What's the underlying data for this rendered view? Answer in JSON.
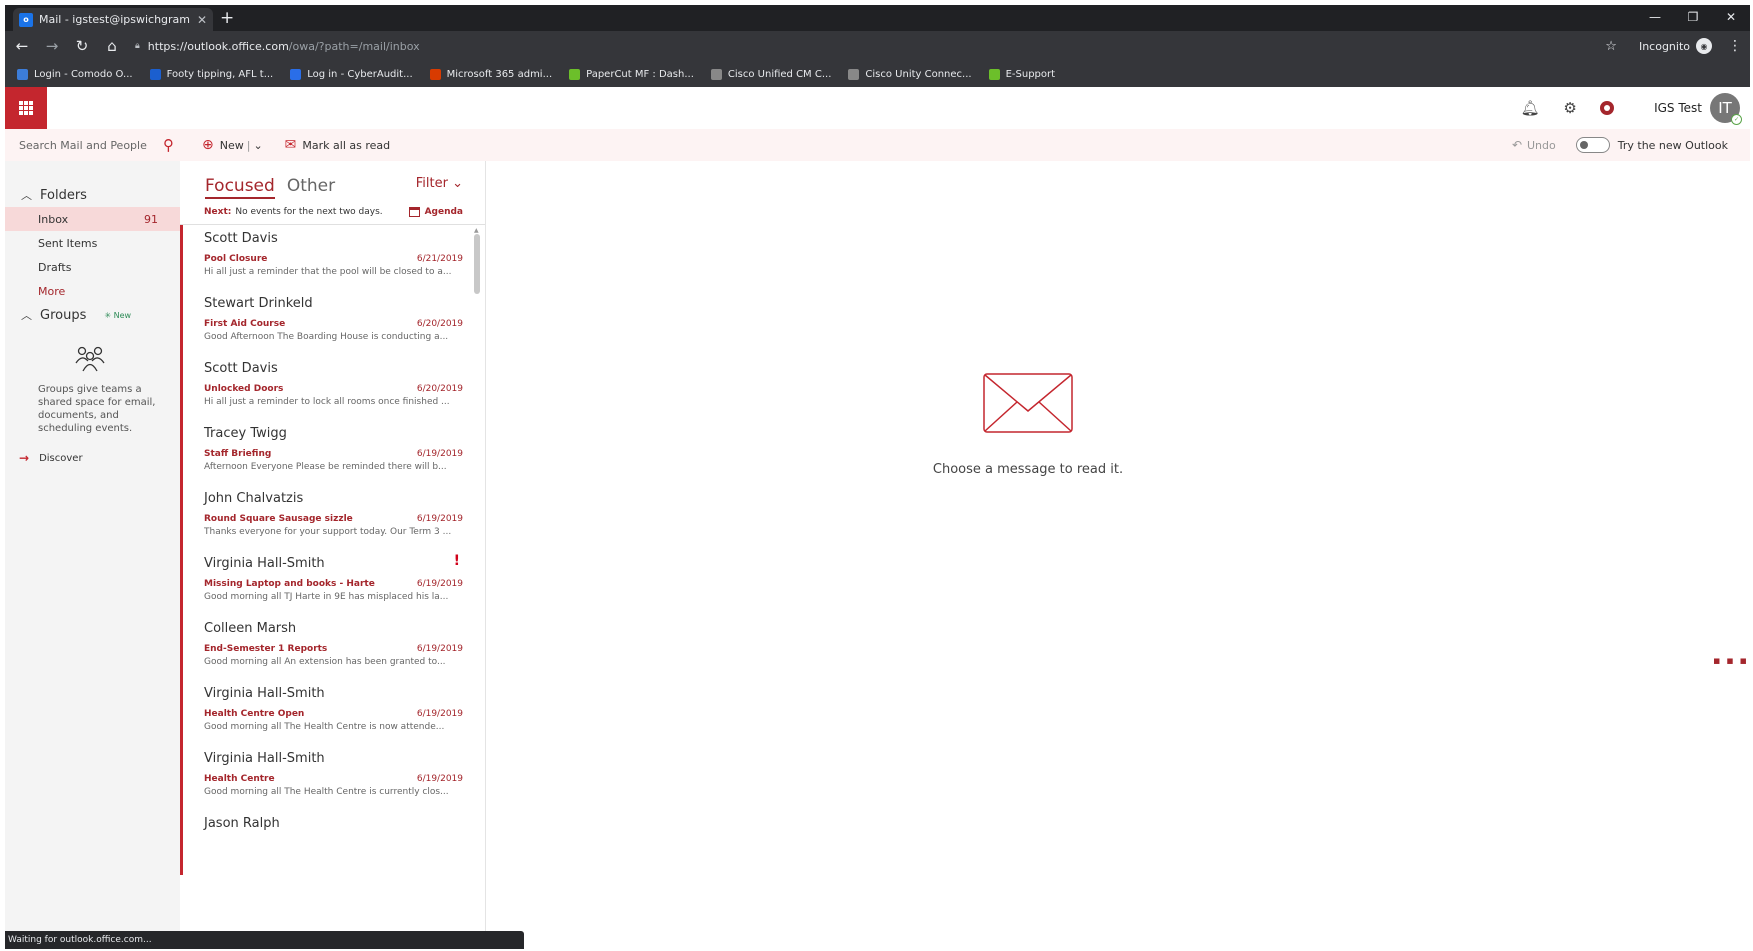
{
  "browser": {
    "tab_title": "Mail - igstest@ipswichgrammar...",
    "tab_favicon": "outlook-icon",
    "url_host": "https://outlook.office.com",
    "url_path": "/owa/?path=/mail/inbox",
    "incognito_label": "Incognito",
    "bookmarks": [
      {
        "label": "Login - Comodo O...",
        "icon": "comodo-icon",
        "color": "#3c7dd9"
      },
      {
        "label": "Footy tipping, AFL t...",
        "icon": "ft-icon",
        "color": "#1b5fcf"
      },
      {
        "label": "Log in - CyberAudit...",
        "icon": "cyberaudit-icon",
        "color": "#2a6ee8"
      },
      {
        "label": "Microsoft 365 admi...",
        "icon": "office-icon",
        "color": "#d83b01"
      },
      {
        "label": "PaperCut MF : Dash...",
        "icon": "papercut-icon",
        "color": "#6cbf2a"
      },
      {
        "label": "Cisco Unified CM C...",
        "icon": "cisco-icon",
        "color": "#888888"
      },
      {
        "label": "Cisco Unity Connec...",
        "icon": "cisco-icon",
        "color": "#888888"
      },
      {
        "label": "E-Support",
        "icon": "esupport-icon",
        "color": "#6cbf2a"
      }
    ],
    "status": "Waiting for outlook.office.com..."
  },
  "owa": {
    "accent": "#c4262e",
    "user_name": "IGS Test",
    "avatar_initials": "IT",
    "search_placeholder": "Search Mail and People",
    "new_label": "New",
    "mark_all_read_label": "Mark all as read",
    "undo_label": "Undo",
    "try_new_label": "Try the new Outlook"
  },
  "nav": {
    "folders_label": "Folders",
    "folders": [
      {
        "name": "Inbox",
        "count": "91",
        "active": true
      },
      {
        "name": "Sent Items",
        "count": ""
      },
      {
        "name": "Drafts",
        "count": ""
      }
    ],
    "more_label": "More",
    "groups_label": "Groups",
    "groups_new_tag": "New",
    "groups_desc": "Groups give teams a shared space for email, documents, and scheduling events.",
    "discover_label": "Discover"
  },
  "list": {
    "tab_focused": "Focused",
    "tab_other": "Other",
    "filter_label": "Filter",
    "next_label": "Next:",
    "next_text": "No events for the next two days.",
    "agenda_label": "Agenda",
    "messages": [
      {
        "sender": "Scott Davis",
        "subject": "Pool Closure",
        "date": "6/21/2019",
        "preview": "Hi all just a reminder that the pool will be closed to a...",
        "flag": ""
      },
      {
        "sender": "Stewart Drinkeld",
        "subject": "First Aid Course",
        "date": "6/20/2019",
        "preview": "Good Afternoon The Boarding House is conducting a...",
        "flag": ""
      },
      {
        "sender": "Scott Davis",
        "subject": "Unlocked Doors",
        "date": "6/20/2019",
        "preview": "Hi all just a reminder to lock all rooms once finished ...",
        "flag": ""
      },
      {
        "sender": "Tracey Twigg",
        "subject": "Staff Briefing",
        "date": "6/19/2019",
        "preview": "Afternoon Everyone  Please be reminded there will b...",
        "flag": ""
      },
      {
        "sender": "John Chalvatzis",
        "subject": "Round Square Sausage sizzle",
        "date": "6/19/2019",
        "preview": "Thanks everyone for your support today. Our Term 3 ...",
        "flag": ""
      },
      {
        "sender": "Virginia Hall-Smith",
        "subject": "Missing Laptop and books - Harte",
        "date": "6/19/2019",
        "preview": "Good morning all  TJ Harte in 9E has misplaced his la...",
        "flag": "!"
      },
      {
        "sender": "Colleen Marsh",
        "subject": "End-Semester 1 Reports",
        "date": "6/19/2019",
        "preview": "Good morning all  An extension has been granted to...",
        "flag": ""
      },
      {
        "sender": "Virginia Hall-Smith",
        "subject": "Health Centre Open",
        "date": "6/19/2019",
        "preview": "Good morning all  The Health Centre is now attende...",
        "flag": ""
      },
      {
        "sender": "Virginia Hall-Smith",
        "subject": "Health Centre",
        "date": "6/19/2019",
        "preview": "Good morning all  The Health Centre is currently clos...",
        "flag": ""
      },
      {
        "sender": "Jason Ralph",
        "subject": "",
        "date": "",
        "preview": "",
        "flag": ""
      }
    ]
  },
  "reading": {
    "empty_text": "Choose a message to read it."
  }
}
